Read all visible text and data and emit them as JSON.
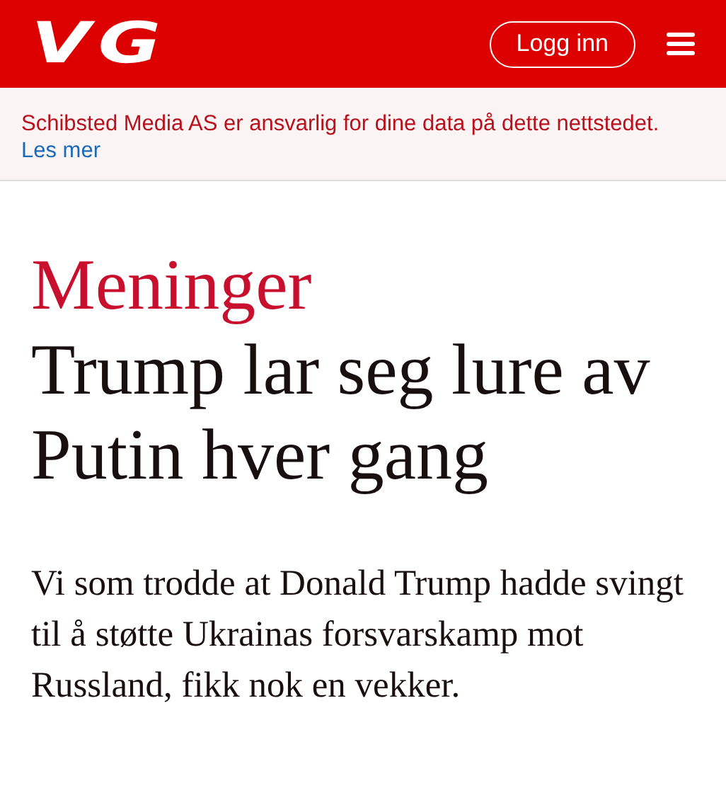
{
  "header": {
    "logo": "VG",
    "login_button": "Logg inn"
  },
  "notice": {
    "text": "Schibsted Media AS er ansvarlig for dine data på dette nettstedet.",
    "link": "Les mer"
  },
  "article": {
    "section": "Meninger",
    "headline": "Trump lar seg lure av Putin hver gang",
    "lead": "Vi som trodde at Donald Trump hadde svingt til å støtte Ukrainas forsvarskamp mot Russland, fikk nok en vekker."
  }
}
